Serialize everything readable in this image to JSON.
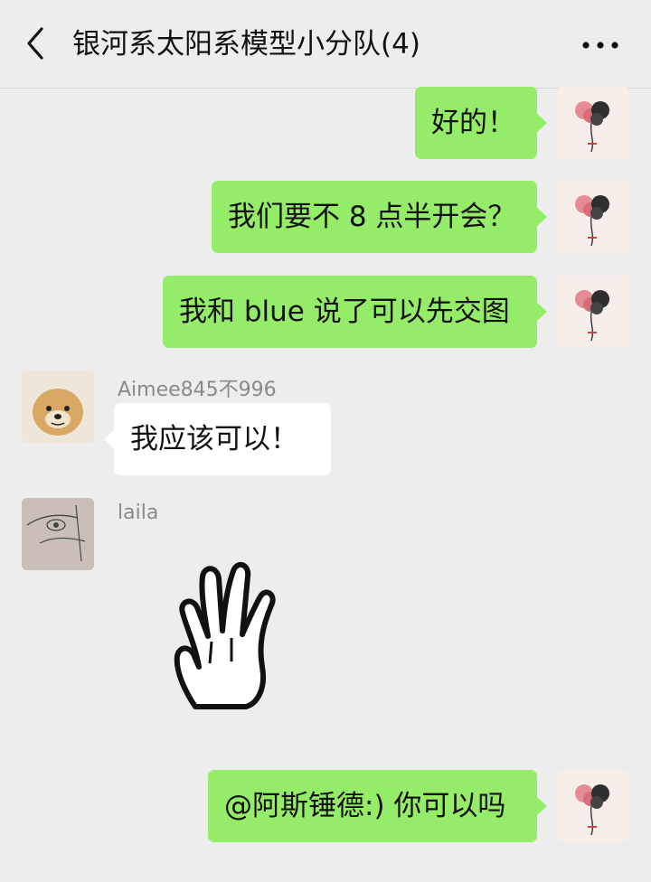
{
  "header": {
    "title": "银河系太阳系模型小分队(4)",
    "back_icon": "chevron-left-icon",
    "more_icon": "more-dots-icon"
  },
  "messages": [
    {
      "from": "self",
      "text": "好的！"
    },
    {
      "from": "self",
      "text": "我们要不 8 点半开会？"
    },
    {
      "from": "self",
      "text": "我和 blue 说了可以先交图"
    },
    {
      "from": "other",
      "sender": "Aimee845不996",
      "text": "我应该可以！"
    },
    {
      "from": "other",
      "sender": "laila",
      "sticker": "waving-hand-sticker"
    },
    {
      "from": "self",
      "text": "@阿斯锤德:) 你可以吗"
    }
  ],
  "colors": {
    "background": "#ededed",
    "self_bubble": "#95ec69",
    "other_bubble": "#ffffff",
    "name_text": "#8a8a8a"
  }
}
